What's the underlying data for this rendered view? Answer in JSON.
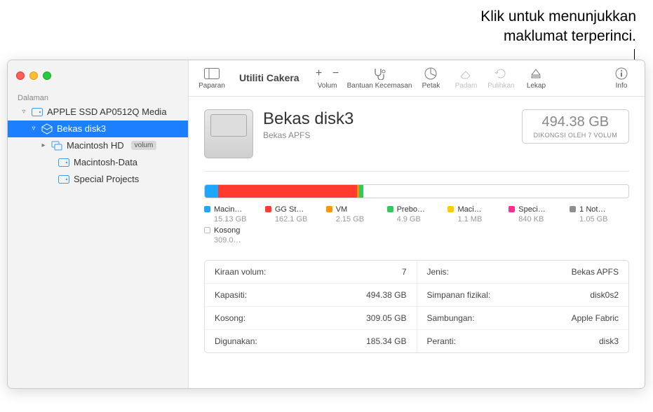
{
  "callout": {
    "line1": "Klik untuk menunjukkan",
    "line2": "maklumat terperinci."
  },
  "window_title": "Utiliti Cakera",
  "toolbar": {
    "view": "Paparan",
    "volume": "Volum",
    "firstaid": "Bantuan Kecemasan",
    "partition": "Petak",
    "erase": "Padam",
    "restore": "Pulihkan",
    "mount": "Lekap",
    "info": "Info"
  },
  "sidebar": {
    "section": "Dalaman",
    "items": [
      {
        "label": "APPLE SSD AP0512Q Media",
        "indent": 0,
        "chev": "▿",
        "icon": "disk",
        "selected": false,
        "tag": ""
      },
      {
        "label": "Bekas disk3",
        "indent": 1,
        "chev": "▿",
        "icon": "box",
        "selected": true,
        "tag": ""
      },
      {
        "label": "Macintosh HD",
        "indent": 2,
        "chev": "▸",
        "icon": "vol",
        "selected": false,
        "tag": "volum"
      },
      {
        "label": "Macintosh-Data",
        "indent": 3,
        "chev": "",
        "icon": "disk",
        "selected": false,
        "tag": ""
      },
      {
        "label": "Special Projects",
        "indent": 3,
        "chev": "",
        "icon": "disk",
        "selected": false,
        "tag": ""
      }
    ]
  },
  "header": {
    "title": "Bekas disk3",
    "subtitle": "Bekas APFS",
    "size": "494.38 GB",
    "shared": "DIKONGSI OLEH 7 VOLUM"
  },
  "usage": {
    "segments": [
      {
        "color": "#1fa6ff",
        "pct": 3.1
      },
      {
        "color": "#ff3b30",
        "pct": 32.8
      },
      {
        "color": "#ff9500",
        "pct": 0.5
      },
      {
        "color": "#34c759",
        "pct": 1.0
      },
      {
        "color": "#ffffff",
        "pct": 62.6
      }
    ],
    "legend": [
      {
        "color": "#1fa6ff",
        "label": "Macin…",
        "size": "15.13 GB"
      },
      {
        "color": "#ff3b30",
        "label": "GG St…",
        "size": "162.1 GB"
      },
      {
        "color": "#ff9500",
        "label": "VM",
        "size": "2.15 GB"
      },
      {
        "color": "#34c759",
        "label": "Prebo…",
        "size": "4.9 GB"
      },
      {
        "color": "#ffcc00",
        "label": "Maci…",
        "size": "1.1 MB"
      },
      {
        "color": "#ff2d92",
        "label": "Speci…",
        "size": "840 KB"
      },
      {
        "color": "#8e8e93",
        "label": "1 Not…",
        "size": "1.05 GB"
      },
      {
        "color": "#ffffff",
        "label": "Kosong",
        "size": "309.0…",
        "hollow": true
      }
    ]
  },
  "info": {
    "left": [
      {
        "k": "Kiraan volum:",
        "v": "7"
      },
      {
        "k": "Kapasiti:",
        "v": "494.38 GB"
      },
      {
        "k": "Kosong:",
        "v": "309.05 GB"
      },
      {
        "k": "Digunakan:",
        "v": "185.34 GB"
      }
    ],
    "right": [
      {
        "k": "Jenis:",
        "v": "Bekas APFS"
      },
      {
        "k": "Simpanan fizikal:",
        "v": "disk0s2"
      },
      {
        "k": "Sambungan:",
        "v": "Apple Fabric"
      },
      {
        "k": "Peranti:",
        "v": "disk3"
      }
    ]
  },
  "chart_data": {
    "type": "bar",
    "title": "Bekas disk3 usage",
    "total_gb": 494.38,
    "series": [
      {
        "name": "Macintosh HD",
        "value_gb": 15.13,
        "color": "#1fa6ff"
      },
      {
        "name": "GG St…",
        "value_gb": 162.1,
        "color": "#ff3b30"
      },
      {
        "name": "VM",
        "value_gb": 2.15,
        "color": "#ff9500"
      },
      {
        "name": "Preboot",
        "value_gb": 4.9,
        "color": "#34c759"
      },
      {
        "name": "Macintosh…",
        "value_gb": 0.0011,
        "color": "#ffcc00"
      },
      {
        "name": "Special Projects",
        "value_gb": 0.00084,
        "color": "#ff2d92"
      },
      {
        "name": "1 Not shown",
        "value_gb": 1.05,
        "color": "#8e8e93"
      },
      {
        "name": "Kosong",
        "value_gb": 309.05,
        "color": "#ffffff"
      }
    ]
  }
}
